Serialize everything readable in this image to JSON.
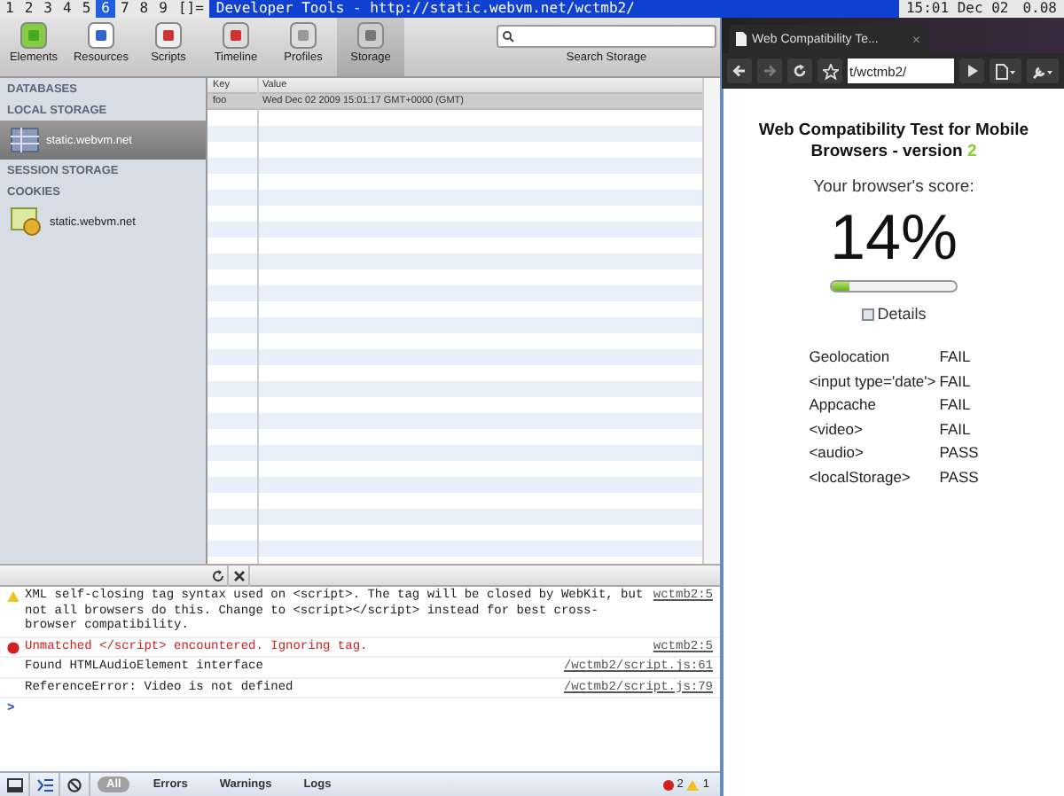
{
  "top_bar": {
    "workspaces": [
      {
        "label": "1",
        "selected": false
      },
      {
        "label": "2",
        "selected": false
      },
      {
        "label": "3",
        "selected": false
      },
      {
        "label": "4",
        "selected": false
      },
      {
        "label": "5",
        "selected": false
      },
      {
        "label": "6",
        "selected": true
      },
      {
        "label": "7",
        "selected": false
      },
      {
        "label": "8",
        "selected": false
      },
      {
        "label": "9",
        "selected": false
      }
    ],
    "layout": "[]=",
    "title": "Developer Tools - http://static.webvm.net/wctmb2/",
    "clock": "15:01 Dec 02",
    "load": "0.08"
  },
  "devtools": {
    "tools": [
      {
        "label": "Elements",
        "kind": "elements",
        "selected": false
      },
      {
        "label": "Resources",
        "kind": "resources",
        "selected": false
      },
      {
        "label": "Scripts",
        "kind": "scripts",
        "selected": false
      },
      {
        "label": "Timeline",
        "kind": "timeline",
        "selected": false
      },
      {
        "label": "Profiles",
        "kind": "profiles",
        "selected": false
      },
      {
        "label": "Storage",
        "kind": "storage",
        "selected": true
      }
    ],
    "search": {
      "label": "Search Storage"
    },
    "sidebar": [
      {
        "kind": "header",
        "label": "DATABASES"
      },
      {
        "kind": "header",
        "label": "LOCAL STORAGE"
      },
      {
        "kind": "table",
        "label": "static.webvm.net",
        "selected": true
      },
      {
        "kind": "header",
        "label": "SESSION STORAGE"
      },
      {
        "kind": "header",
        "label": "COOKIES"
      },
      {
        "kind": "cookie",
        "label": "static.webvm.net",
        "selected": false
      }
    ],
    "table": {
      "columns": [
        "Key",
        "Value"
      ],
      "rows": [
        [
          "foo",
          "Wed Dec 02 2009 15:01:17 GMT+0000 (GMT)"
        ]
      ]
    },
    "console": [
      {
        "kind": "warning",
        "text": "XML self-closing tag syntax used on <script>.  The tag will be closed by WebKit, but not all browsers do this.  Change to <script></script> instead for best cross-browser compatibility.",
        "source": "wctmb2:5"
      },
      {
        "kind": "error",
        "text": "Unmatched </script> encountered.  Ignoring tag.",
        "source": "wctmb2:5"
      },
      {
        "kind": "log",
        "text": "Found HTMLAudioElement interface",
        "source": "/wctmb2/script.js:61"
      },
      {
        "kind": "log",
        "text": "ReferenceError: Video is not defined",
        "source": "/wctmb2/script.js:79"
      }
    ],
    "prompt": ">",
    "filters": [
      {
        "label": "All",
        "selected": true
      },
      {
        "label": "Errors",
        "selected": false
      },
      {
        "label": "Warnings",
        "selected": false
      },
      {
        "label": "Logs",
        "selected": false
      }
    ],
    "error_count": "2",
    "warning_count": "1"
  },
  "browser": {
    "tab_title": "Web Compatibility Te...",
    "tab_close": "×",
    "url": "t/wctmb2/",
    "title": "Web Compatibility Test for Mobile Browsers - version ",
    "version": "2",
    "score_label": "Your browser's score:",
    "score": "14%",
    "level": 0.14,
    "details": {
      "label": "Details",
      "checked": false
    },
    "results": [
      {
        "name": "Geolocation",
        "result": "FAIL"
      },
      {
        "name": "<input type='date'>",
        "result": "FAIL"
      },
      {
        "name": "Appcache",
        "result": "FAIL"
      },
      {
        "name": "<video>",
        "result": "FAIL"
      },
      {
        "name": "<audio>",
        "result": "PASS"
      },
      {
        "name": "<localStorage>",
        "result": "PASS"
      }
    ]
  }
}
